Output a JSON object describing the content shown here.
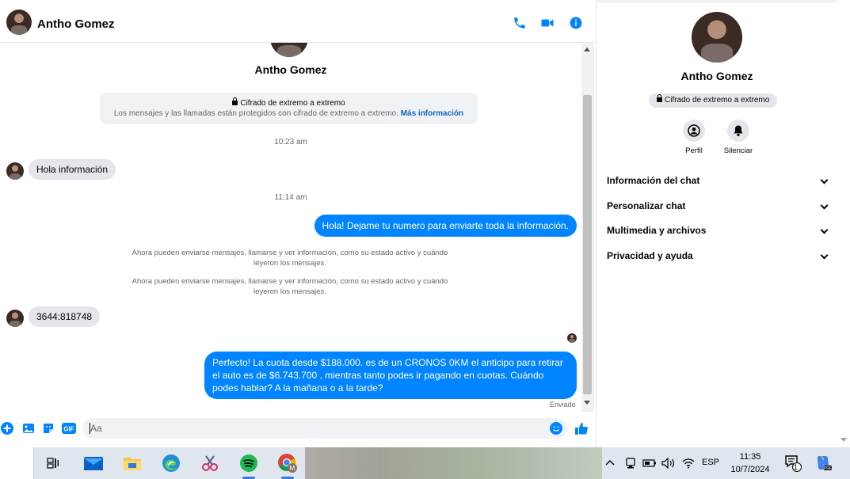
{
  "contact": {
    "name": "Antho Gomez"
  },
  "header": {
    "call_icon": "phone-icon",
    "video_icon": "video-camera-icon",
    "info_icon": "info-icon"
  },
  "encryption": {
    "title": "Cifrado de extremo a extremo",
    "text": "Los mensajes y las llamadas están protegidos con cifrado de extremo a extremo.",
    "link": "Más información"
  },
  "messages": {
    "time1": "10:23 am",
    "in1": "Hola información",
    "time2": "11:14 am",
    "out1": "Hola! Dejame tu numero  para enviarte toda la información.",
    "sys1": "Ahora pueden enviarse mensajes, llamarse y ver información, como su estado activo y cuándo leyeron los mensajes.",
    "sys2": "Ahora pueden enviarse mensajes, llamarse y ver información, como su estado activo y cuándo leyeron los mensajes.",
    "in2": "3644:818748",
    "out2": "Perfecto! La cuota desde $188.000. es de un CRONOS 0KM el anticipo para retirar el auto es de $6.743.700 , mientras tanto podes ir pagando en cuotas. Cuándo podes hablar? A la mañana o a la tarde?",
    "status": "Enviado"
  },
  "composer": {
    "placeholder": "Aa"
  },
  "info_panel": {
    "badge": "Cifrado de extremo a extremo",
    "profile_label": "Perfil",
    "mute_label": "Silenciar",
    "sections": [
      "Información del chat",
      "Personalizar chat",
      "Multimedia y archivos",
      "Privacidad y ayuda"
    ]
  },
  "taskbar": {
    "language": "ESP",
    "time": "11:35",
    "date": "10/7/2024",
    "notification_count": "1"
  },
  "colors": {
    "accent": "#0084ff",
    "incoming_bubble": "#e4e6eb"
  }
}
